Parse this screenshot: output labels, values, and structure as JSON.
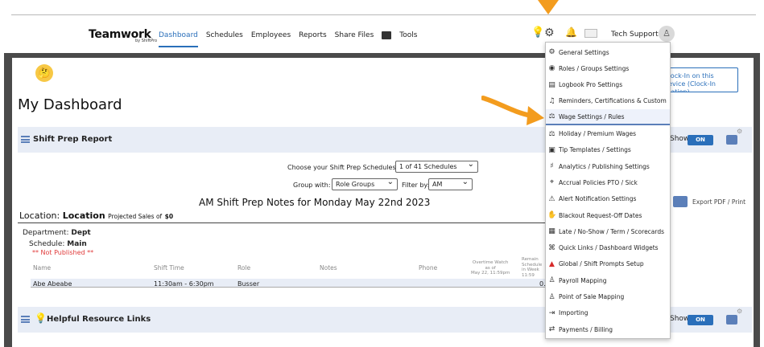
{
  "app": {
    "logo": "Teamwork",
    "logo_sub": "by ShiftPro"
  },
  "nav": {
    "items": [
      "Dashboard",
      "Schedules",
      "Employees",
      "Reports",
      "Share Files",
      "Tools"
    ],
    "active": "Dashboard",
    "user": "Tech Support"
  },
  "page": {
    "title": "My Dashboard",
    "kiosk_text": "Clock-In on this device (Clock-In Station)"
  },
  "shift_prep": {
    "title": "Shift Prep Report",
    "show_label": "Show",
    "toggle": "ON",
    "choose_label": "Choose your Shift Prep Schedules",
    "schedule_select": "1 of 41 Schedules",
    "group_label": "Group with:",
    "group_select": "Role Groups",
    "filter_label": "Filter by:",
    "filter_select": "AM",
    "notes_title": "AM Shift Prep Notes for Monday May 22nd 2023",
    "export_label": "Export PDF / Print",
    "location_label": "Location:",
    "location_value": "Location",
    "projected_label": "Projected Sales of",
    "projected_value": "$0",
    "department_label": "Department:",
    "department_value": "Dept",
    "schedule_label": "Schedule:",
    "schedule_value": "Main",
    "not_published": "** Not Published **",
    "columns": {
      "name": "Name",
      "shift_time": "Shift Time",
      "role": "Role",
      "notes": "Notes",
      "phone": "Phone",
      "overtime_1": "Overtime Watch",
      "overtime_2": "as of",
      "overtime_3": "May 22, 11:59pm",
      "remaining_1": "Remain",
      "remaining_2": "Schedule",
      "remaining_3": "in Week",
      "remaining_4": "11:59"
    },
    "rows": [
      {
        "name": "Abe Abeabe",
        "shift_time": "11:30am - 6:30pm",
        "role": "Busser",
        "remaining": "0."
      }
    ]
  },
  "helpful": {
    "title": "Helpful Resource Links",
    "show_label": "Show",
    "toggle": "ON"
  },
  "menu": {
    "items": [
      {
        "icon": "⚙",
        "label": "General Settings"
      },
      {
        "icon": "◉",
        "label": "Roles / Groups Settings"
      },
      {
        "icon": "▤",
        "label": "Logbook Pro Settings"
      },
      {
        "icon": "♫",
        "label": "Reminders, Certifications & Custom"
      },
      {
        "icon": "⚖",
        "label": "Wage Settings / Rules"
      },
      {
        "icon": "⚖",
        "label": "Holiday / Premium Wages"
      },
      {
        "icon": "▣",
        "label": "Tip Templates / Settings"
      },
      {
        "icon": "♯",
        "label": "Analytics / Publishing Settings"
      },
      {
        "icon": "⌖",
        "label": "Accrual Policies PTO / Sick"
      },
      {
        "icon": "⚠",
        "label": "Alert Notification Settings"
      },
      {
        "icon": "✋",
        "label": "Blackout Request-Off Dates"
      },
      {
        "icon": "▦",
        "label": "Late / No-Show / Term / Scorecards"
      },
      {
        "icon": "⌘",
        "label": "Quick Links / Dashboard Widgets"
      },
      {
        "icon": "▲",
        "label": "Global / Shift Prompts Setup"
      },
      {
        "icon": "♙",
        "label": "Payroll Mapping"
      },
      {
        "icon": "♙",
        "label": "Point of Sale Mapping"
      },
      {
        "icon": "⇥",
        "label": "Importing"
      },
      {
        "icon": "⇄",
        "label": "Payments / Billing"
      }
    ],
    "highlighted": "Wage Settings / Rules"
  },
  "colors": {
    "accent": "#2a6fba",
    "arrow": "#f39c1e",
    "panel_header": "#e8edf6",
    "not_published": "#e03a3a",
    "frame": "#4a4a4a"
  }
}
